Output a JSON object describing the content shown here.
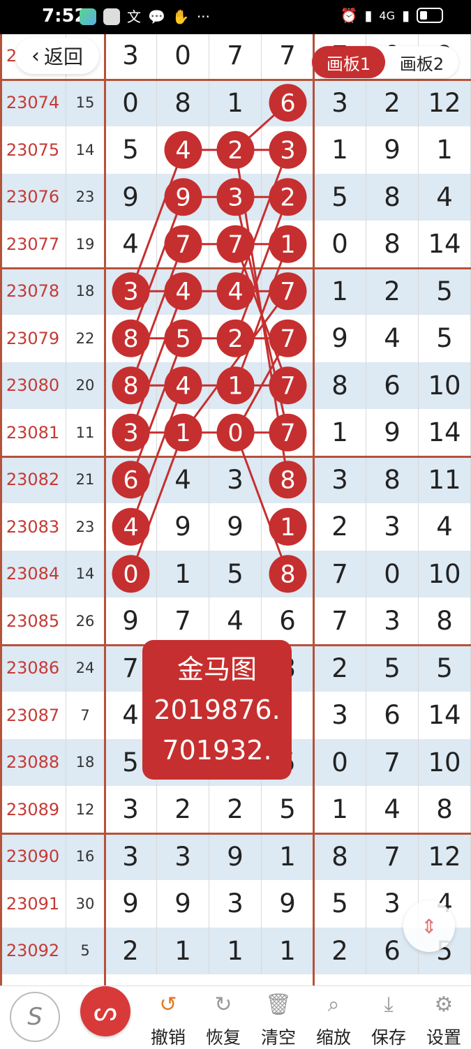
{
  "status_bar": {
    "time": "7:52",
    "network": "4G"
  },
  "nav": {
    "back_label": "返回",
    "tabs": [
      "画板1",
      "画板2"
    ],
    "active_tab": 0
  },
  "table": {
    "rows": [
      {
        "id": "23073",
        "sum": "17",
        "main": [
          "3",
          "0",
          "7",
          "7"
        ],
        "side": [
          "7",
          "0",
          "9"
        ]
      },
      {
        "id": "23074",
        "sum": "15",
        "main": [
          "0",
          "8",
          "1",
          "6"
        ],
        "side": [
          "3",
          "2",
          "12"
        ]
      },
      {
        "id": "23075",
        "sum": "14",
        "main": [
          "5",
          "4",
          "2",
          "3"
        ],
        "side": [
          "1",
          "9",
          "1"
        ]
      },
      {
        "id": "23076",
        "sum": "23",
        "main": [
          "9",
          "9",
          "3",
          "2"
        ],
        "side": [
          "5",
          "8",
          "4"
        ]
      },
      {
        "id": "23077",
        "sum": "19",
        "main": [
          "4",
          "7",
          "7",
          "1"
        ],
        "side": [
          "0",
          "8",
          "14"
        ]
      },
      {
        "id": "23078",
        "sum": "18",
        "main": [
          "3",
          "4",
          "4",
          "7"
        ],
        "side": [
          "1",
          "2",
          "5"
        ]
      },
      {
        "id": "23079",
        "sum": "22",
        "main": [
          "8",
          "5",
          "2",
          "7"
        ],
        "side": [
          "9",
          "4",
          "5"
        ]
      },
      {
        "id": "23080",
        "sum": "20",
        "main": [
          "8",
          "4",
          "1",
          "7"
        ],
        "side": [
          "8",
          "6",
          "10"
        ]
      },
      {
        "id": "23081",
        "sum": "11",
        "main": [
          "3",
          "1",
          "0",
          "7"
        ],
        "side": [
          "1",
          "9",
          "14"
        ]
      },
      {
        "id": "23082",
        "sum": "21",
        "main": [
          "6",
          "4",
          "3",
          "8"
        ],
        "side": [
          "3",
          "8",
          "11"
        ]
      },
      {
        "id": "23083",
        "sum": "23",
        "main": [
          "4",
          "9",
          "9",
          "1"
        ],
        "side": [
          "2",
          "3",
          "4"
        ]
      },
      {
        "id": "23084",
        "sum": "14",
        "main": [
          "0",
          "1",
          "5",
          "8"
        ],
        "side": [
          "7",
          "0",
          "10"
        ]
      },
      {
        "id": "23085",
        "sum": "26",
        "main": [
          "9",
          "7",
          "4",
          "6"
        ],
        "side": [
          "7",
          "3",
          "8"
        ]
      },
      {
        "id": "23086",
        "sum": "24",
        "main": [
          "7",
          "",
          "",
          "8"
        ],
        "side": [
          "2",
          "5",
          "5"
        ]
      },
      {
        "id": "23087",
        "sum": "7",
        "main": [
          "4",
          "",
          "",
          ""
        ],
        "side": [
          "3",
          "6",
          "14"
        ]
      },
      {
        "id": "23088",
        "sum": "18",
        "main": [
          "5",
          "6",
          "2",
          "5"
        ],
        "side": [
          "0",
          "7",
          "10"
        ]
      },
      {
        "id": "23089",
        "sum": "12",
        "main": [
          "3",
          "2",
          "2",
          "5"
        ],
        "side": [
          "1",
          "4",
          "8"
        ]
      },
      {
        "id": "23090",
        "sum": "16",
        "main": [
          "3",
          "3",
          "9",
          "1"
        ],
        "side": [
          "8",
          "7",
          "12"
        ]
      },
      {
        "id": "23091",
        "sum": "30",
        "main": [
          "9",
          "9",
          "3",
          "9"
        ],
        "side": [
          "5",
          "3",
          "4"
        ]
      },
      {
        "id": "23092",
        "sum": "5",
        "main": [
          "2",
          "1",
          "1",
          "1"
        ],
        "side": [
          "2",
          "6",
          "5"
        ]
      }
    ]
  },
  "marked": [
    {
      "row": 1,
      "col": 3
    },
    {
      "row": 2,
      "col": 1
    },
    {
      "row": 2,
      "col": 2
    },
    {
      "row": 2,
      "col": 3
    },
    {
      "row": 3,
      "col": 1
    },
    {
      "row": 3,
      "col": 2
    },
    {
      "row": 3,
      "col": 3
    },
    {
      "row": 4,
      "col": 1
    },
    {
      "row": 4,
      "col": 2
    },
    {
      "row": 4,
      "col": 3
    },
    {
      "row": 5,
      "col": 0
    },
    {
      "row": 5,
      "col": 1
    },
    {
      "row": 5,
      "col": 2
    },
    {
      "row": 5,
      "col": 3
    },
    {
      "row": 6,
      "col": 0
    },
    {
      "row": 6,
      "col": 1
    },
    {
      "row": 6,
      "col": 2
    },
    {
      "row": 6,
      "col": 3
    },
    {
      "row": 7,
      "col": 0
    },
    {
      "row": 7,
      "col": 1
    },
    {
      "row": 7,
      "col": 2
    },
    {
      "row": 7,
      "col": 3
    },
    {
      "row": 8,
      "col": 0
    },
    {
      "row": 8,
      "col": 1
    },
    {
      "row": 8,
      "col": 2
    },
    {
      "row": 8,
      "col": 3
    },
    {
      "row": 9,
      "col": 0
    },
    {
      "row": 9,
      "col": 3
    },
    {
      "row": 10,
      "col": 0
    },
    {
      "row": 10,
      "col": 3
    },
    {
      "row": 11,
      "col": 0
    },
    {
      "row": 11,
      "col": 3
    }
  ],
  "lines": [
    [
      {
        "row": 5,
        "col": 0
      },
      {
        "row": 2,
        "col": 1
      }
    ],
    [
      {
        "row": 6,
        "col": 0
      },
      {
        "row": 3,
        "col": 1
      }
    ],
    [
      {
        "row": 7,
        "col": 0
      },
      {
        "row": 4,
        "col": 1
      }
    ],
    [
      {
        "row": 8,
        "col": 0
      },
      {
        "row": 5,
        "col": 1
      }
    ],
    [
      {
        "row": 9,
        "col": 0
      },
      {
        "row": 6,
        "col": 1
      }
    ],
    [
      {
        "row": 10,
        "col": 0
      },
      {
        "row": 7,
        "col": 1
      }
    ],
    [
      {
        "row": 11,
        "col": 0
      },
      {
        "row": 8,
        "col": 1
      }
    ],
    [
      {
        "row": 5,
        "col": 0
      },
      {
        "row": 5,
        "col": 3
      }
    ],
    [
      {
        "row": 6,
        "col": 0
      },
      {
        "row": 6,
        "col": 3
      }
    ],
    [
      {
        "row": 7,
        "col": 0
      },
      {
        "row": 7,
        "col": 3
      }
    ],
    [
      {
        "row": 8,
        "col": 0
      },
      {
        "row": 8,
        "col": 3
      }
    ],
    [
      {
        "row": 2,
        "col": 1
      },
      {
        "row": 2,
        "col": 3
      }
    ],
    [
      {
        "row": 3,
        "col": 1
      },
      {
        "row": 3,
        "col": 3
      }
    ],
    [
      {
        "row": 4,
        "col": 1
      },
      {
        "row": 4,
        "col": 3
      }
    ],
    [
      {
        "row": 2,
        "col": 2
      },
      {
        "row": 1,
        "col": 3
      }
    ],
    [
      {
        "row": 5,
        "col": 2
      },
      {
        "row": 2,
        "col": 3
      }
    ],
    [
      {
        "row": 6,
        "col": 2
      },
      {
        "row": 3,
        "col": 3
      }
    ],
    [
      {
        "row": 7,
        "col": 2
      },
      {
        "row": 4,
        "col": 3
      }
    ],
    [
      {
        "row": 8,
        "col": 1
      },
      {
        "row": 5,
        "col": 3
      }
    ],
    [
      {
        "row": 8,
        "col": 2
      },
      {
        "row": 6,
        "col": 3
      }
    ],
    [
      {
        "row": 2,
        "col": 2
      },
      {
        "row": 9,
        "col": 3
      }
    ],
    [
      {
        "row": 3,
        "col": 2
      },
      {
        "row": 8,
        "col": 3
      }
    ],
    [
      {
        "row": 4,
        "col": 2
      },
      {
        "row": 7,
        "col": 3
      }
    ],
    [
      {
        "row": 8,
        "col": 2
      },
      {
        "row": 11,
        "col": 3
      }
    ]
  ],
  "popup": {
    "title": "金马图",
    "line1": "2019876.",
    "line2": "701932."
  },
  "toolbar": {
    "s_label": "S",
    "buttons": [
      {
        "label": "撤销",
        "icon": "undo-icon"
      },
      {
        "label": "恢复",
        "icon": "redo-icon"
      },
      {
        "label": "清空",
        "icon": "trash-icon"
      },
      {
        "label": "缩放",
        "icon": "zoom-icon"
      },
      {
        "label": "保存",
        "icon": "download-icon"
      },
      {
        "label": "设置",
        "icon": "gear-icon"
      }
    ]
  },
  "colors": {
    "ball": "#c62f2f",
    "id_text": "#c53a34",
    "row_alt": "#dde9f3",
    "section_line": "#b5523a"
  }
}
